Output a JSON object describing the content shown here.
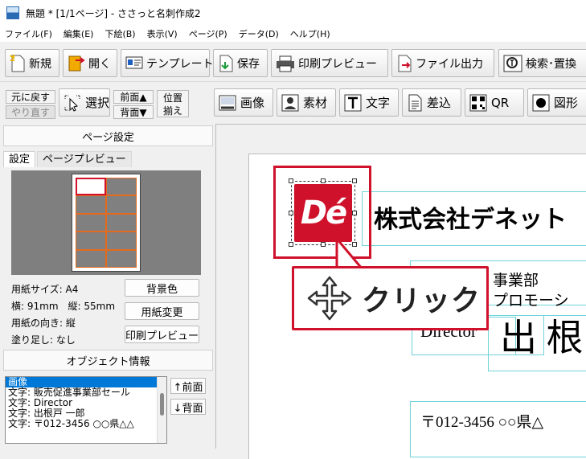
{
  "window": {
    "title": "無題 * [1/1ページ] - ささっと名刺作成2"
  },
  "menu": [
    {
      "label": "ファイル(F)"
    },
    {
      "label": "編集(E)"
    },
    {
      "label": "下絵(B)"
    },
    {
      "label": "表示(V)"
    },
    {
      "label": "ページ(P)"
    },
    {
      "label": "データ(D)"
    },
    {
      "label": "ヘルプ(H)"
    }
  ],
  "toolbar_main": {
    "new": "新規",
    "open": "開く",
    "template": "テンプレート",
    "save": "保存",
    "print_preview": "印刷プレビュー",
    "file_output": "ファイル出力",
    "search_replace": "検索･置換"
  },
  "toolbar_edit": {
    "undo": "元に戻す",
    "redo": "やり直す",
    "select": "選択",
    "front": "前面▲",
    "back": "背面▼",
    "align_top": "位置",
    "align_bottom": "揃え",
    "image": "画像",
    "material": "素材",
    "text": "文字",
    "insert": "差込",
    "qr": "QR",
    "shape": "図形"
  },
  "page_settings": {
    "header": "ページ設定",
    "tab_settings": "設定",
    "tab_preview": "ページプレビュー",
    "paper_size": "用紙サイズ: A4",
    "dimensions": "横: 91mm　縦: 55mm",
    "orientation": "用紙の向き: 縦",
    "bleed": "塗り足し: なし",
    "btn_background": "背景色",
    "btn_paper_change": "用紙変更",
    "btn_print_preview": "印刷プレビュー"
  },
  "object_info": {
    "header": "オブジェクト情報",
    "items": [
      "画像",
      "文字: 販売促進事業部セール",
      "文字: Director",
      "文字: 出根戸 一郎",
      "文字: 〒012-3456 ○○県△△"
    ],
    "selected_index": 0,
    "btn_front": "↑前面",
    "btn_back": "↓背面"
  },
  "card": {
    "logo_text": "Dé",
    "company": "株式会社デネット",
    "department": "事業部",
    "promotion": "プロモーシ",
    "title": "Director",
    "name": "出 根",
    "address": "〒012-3456 ○○県△"
  },
  "callout": {
    "label": "クリック"
  },
  "colors": {
    "accent_red": "#d0112b",
    "frame_cyan": "#6fd3da",
    "selection_blue": "#0078d7"
  }
}
